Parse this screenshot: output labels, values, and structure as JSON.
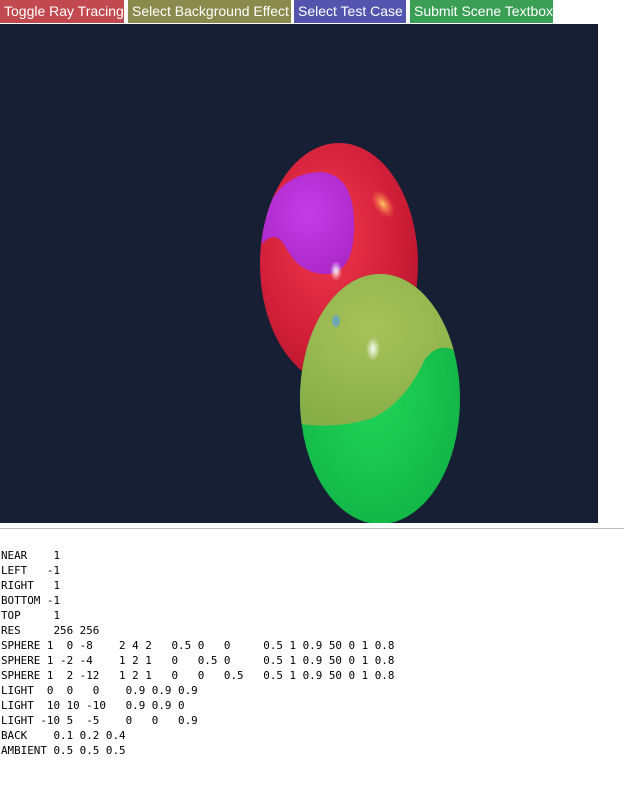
{
  "toolbar": {
    "toggle_label": "Toggle Ray Tracing",
    "background_label": "Select Background Effect",
    "testcase_label": "Select Test Case",
    "submit_label": "Submit Scene Textbox"
  },
  "colors": {
    "toggle": "#c1494f",
    "background_effect": "#8a8a4c",
    "test_case": "#5354ad",
    "submit": "#3a9e55",
    "canvas_background": "#161f34"
  },
  "scene": {
    "text": "NEAR    1\nLEFT   -1\nRIGHT   1\nBOTTOM -1\nTOP     1\nRES     256 256\nSPHERE 1  0 -8    2 4 2   0.5 0   0     0.5 1 0.9 50 0 1 0.8\nSPHERE 1 -2 -4    1 2 1   0   0.5 0     0.5 1 0.9 50 0 1 0.8\nSPHERE 1  2 -12   1 2 1   0   0   0.5   0.5 1 0.9 50 0 1 0.8\nLIGHT  0  0   0    0.9 0.9 0.9\nLIGHT  10 10 -10   0.9 0.9 0\nLIGHT -10 5  -5    0   0   0.9\nBACK    0.1 0.2 0.4\nAMBIENT 0.5 0.5 0.5"
  }
}
